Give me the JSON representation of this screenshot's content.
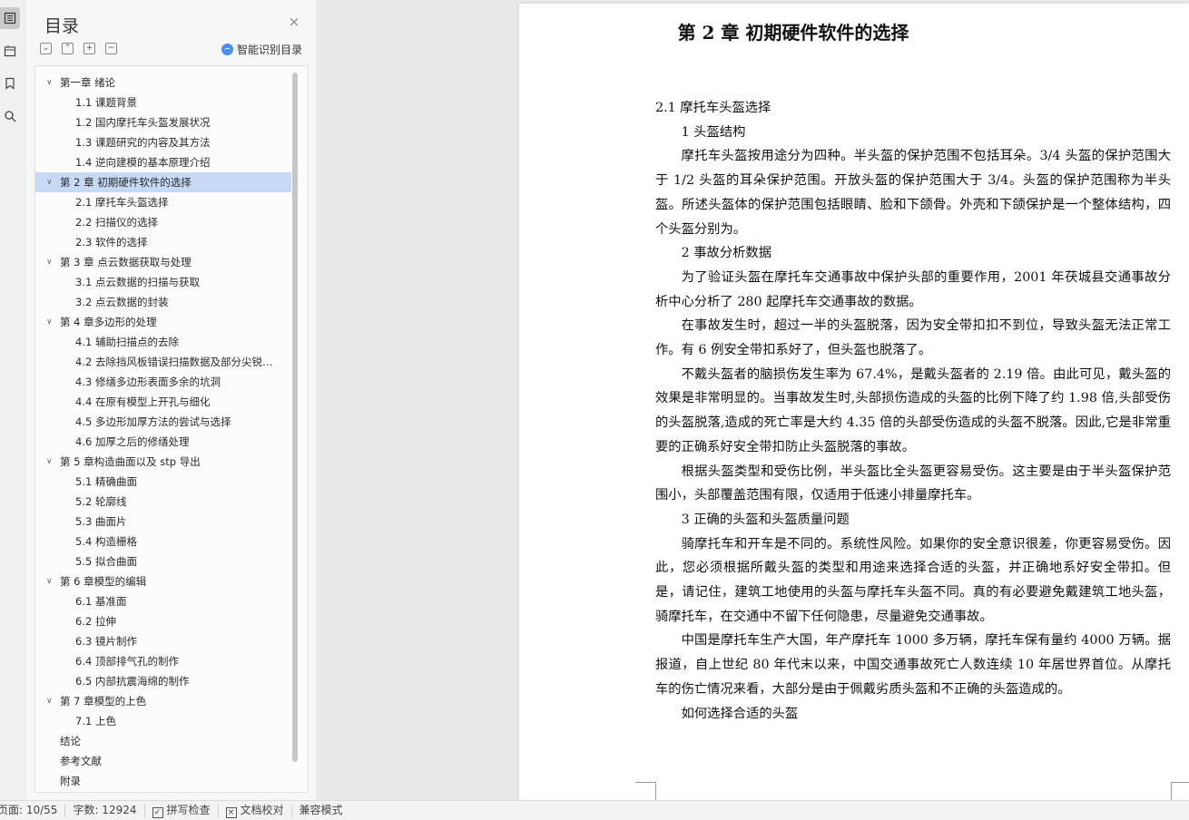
{
  "rail": {
    "icons": [
      "toc-icon",
      "nav-icon",
      "bookmark-icon",
      "search-icon"
    ]
  },
  "toc": {
    "title": "目录",
    "close_glyph": "×",
    "smart_label": "智能识别目录",
    "items": [
      {
        "label": "第一章  绪论",
        "level": 1,
        "expanded": true
      },
      {
        "label": "1.1 课题背景",
        "level": 2
      },
      {
        "label": "1.2 国内摩托车头盔发展状况",
        "level": 2
      },
      {
        "label": "1.3 课题研究的内容及其方法",
        "level": 2
      },
      {
        "label": "1.4 逆向建模的基本原理介绍",
        "level": 2
      },
      {
        "label": "第 2 章  初期硬件软件的选择",
        "level": 1,
        "expanded": true,
        "selected": true
      },
      {
        "label": "2.1 摩托车头盔选择",
        "level": 2
      },
      {
        "label": "2.2 扫描仪的选择",
        "level": 2
      },
      {
        "label": "2.3  软件的选择",
        "level": 2
      },
      {
        "label": "第 3 章    点云数据获取与处理",
        "level": 1,
        "expanded": true
      },
      {
        "label": "3.1  点云数据的扫描与获取",
        "level": 2
      },
      {
        "label": "3.2  点云数据的封装",
        "level": 2
      },
      {
        "label": "第 4 章多边形的处理",
        "level": 1,
        "expanded": true
      },
      {
        "label": "4.1  辅助扫描点的去除",
        "level": 2
      },
      {
        "label": "4.2  去除挡风板错误扫描数据及部分尖锐…",
        "level": 2
      },
      {
        "label": "4.3  修缮多边形表面多余的坑洞",
        "level": 2
      },
      {
        "label": "4.4  在原有模型上开孔与细化",
        "level": 2
      },
      {
        "label": "4.5  多边形加厚方法的尝试与选择",
        "level": 2
      },
      {
        "label": "4.6  加厚之后的修缮处理",
        "level": 2
      },
      {
        "label": "第 5 章构造曲面以及 stp 导出",
        "level": 1,
        "expanded": true
      },
      {
        "label": "5.1  精确曲面",
        "level": 2
      },
      {
        "label": "5.2  轮廓线",
        "level": 2
      },
      {
        "label": "5.3  曲面片",
        "level": 2
      },
      {
        "label": "5.4  构造栅格",
        "level": 2
      },
      {
        "label": "5.5  拟合曲面",
        "level": 2
      },
      {
        "label": "第 6 章模型的编辑",
        "level": 1,
        "expanded": true
      },
      {
        "label": "6.1  基准面",
        "level": 2
      },
      {
        "label": "6.2  拉伸",
        "level": 2
      },
      {
        "label": "6.3  镜片制作",
        "level": 2
      },
      {
        "label": "6.4  顶部排气孔的制作",
        "level": 2
      },
      {
        "label": "6.5  内部抗震海绵的制作",
        "level": 2
      },
      {
        "label": "第 7 章模型的上色",
        "level": 1,
        "expanded": true
      },
      {
        "label": "7.1  上色",
        "level": 2
      },
      {
        "label": "结论",
        "level": 1
      },
      {
        "label": "参考文献",
        "level": 1
      },
      {
        "label": "附录",
        "level": 1
      }
    ]
  },
  "document": {
    "chapter_title": "第 2 章  初期硬件软件的选择",
    "paragraphs": [
      {
        "text": "2.1 摩托车头盔选择",
        "indent": false
      },
      {
        "text": "1 头盔结构",
        "indent": true
      },
      {
        "text": "摩托车头盔按用途分为四种。半头盔的保护范围不包括耳朵。3/4 头盔的保护范围大于 1/2 头盔的耳朵保护范围。开放头盔的保护范围大于 3/4。头盔的保护范围称为半头盔。所述头盔体的保护范围包括眼睛、脸和下颌骨。外壳和下颌保护是一个整体结构，四个头盔分别为。",
        "indent": true
      },
      {
        "text": "2 事故分析数据",
        "indent": true
      },
      {
        "text": "为了验证头盔在摩托车交通事故中保护头部的重要作用，2001 年茯城县交通事故分析中心分析了 280 起摩托车交通事故的数据。",
        "indent": true
      },
      {
        "text": "在事故发生时，超过一半的头盔脱落，因为安全带扣扣不到位，导致头盔无法正常工作。有 6 例安全带扣系好了，但头盔也脱落了。",
        "indent": true
      },
      {
        "text": "不戴头盔者的脑损伤发生率为 67.4%，是戴头盔者的 2.19 倍。由此可见，戴头盔的效果是非常明显的。当事故发生时,头部损伤造成的头盔的比例下降了约 1.98 倍,头部受伤的头盔脱落,造成的死亡率是大约 4.35 倍的头部受伤造成的头盔不脱落。因此,它是非常重要的正确系好安全带扣防止头盔脱落的事故。",
        "indent": true
      },
      {
        "text": "根据头盔类型和受伤比例，半头盔比全头盔更容易受伤。这主要是由于半头盔保护范围小，头部覆盖范围有限，仅适用于低速小排量摩托车。",
        "indent": true
      },
      {
        "text": "3 正确的头盔和头盔质量问题",
        "indent": true
      },
      {
        "text": "骑摩托车和开车是不同的。系统性风险。如果你的安全意识很差，你更容易受伤。因此，您必须根据所戴头盔的类型和用途来选择合适的头盔，并正确地系好安全带扣。但是，请记住，建筑工地使用的头盔与摩托车头盔不同。真的有必要避免戴建筑工地头盔，骑摩托车，在交通中不留下任何隐患，尽量避免交通事故。",
        "indent": true
      },
      {
        "text": "中国是摩托车生产大国，年产摩托车 1000 多万辆，摩托车保有量约 4000 万辆。据报道，自上世纪 80 年代末以来，中国交通事故死亡人数连续 10 年居世界首位。从摩托车的伤亡情况来看，大部分是由于佩戴劣质头盔和不正确的头盔造成的。",
        "indent": true
      },
      {
        "text": "如何选择合适的头盔",
        "indent": true
      }
    ]
  },
  "status_bar": {
    "page": "页面: 10/55",
    "word_count": "字数: 12924",
    "spell_check": "拼写检查",
    "doc_check": "文档校对",
    "compat_mode": "兼容模式"
  }
}
